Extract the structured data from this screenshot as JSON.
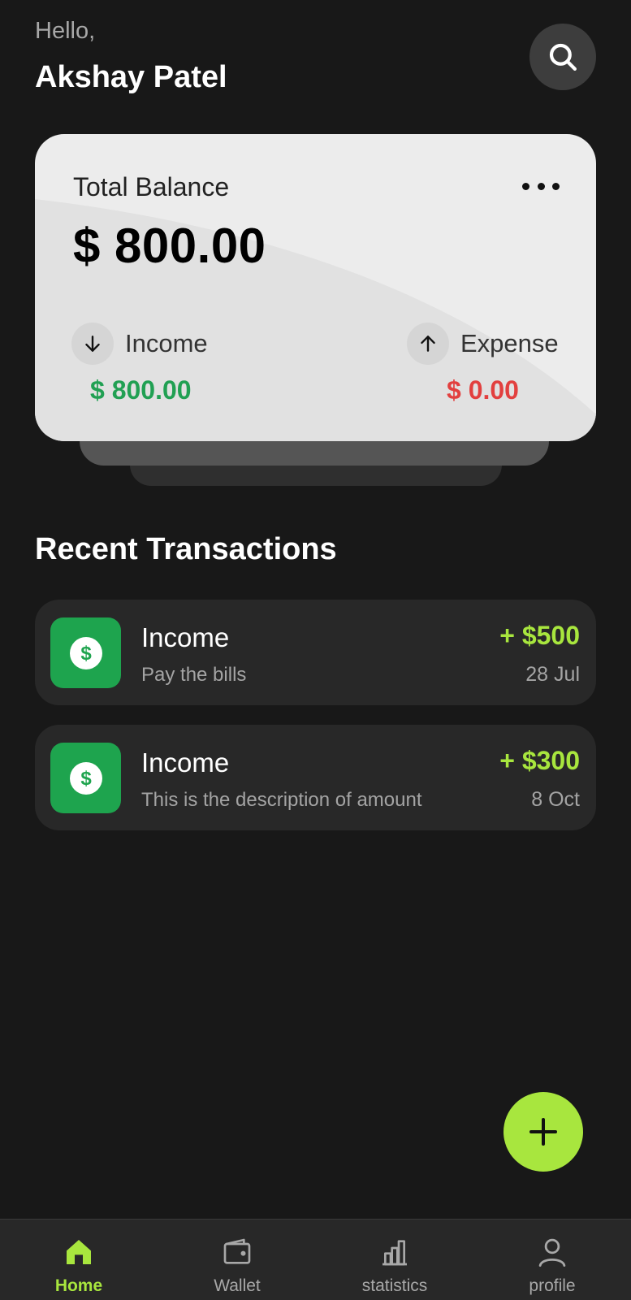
{
  "header": {
    "greeting": "Hello,",
    "username": "Akshay Patel",
    "search_icon": "search-icon"
  },
  "balance_card": {
    "label": "Total Balance",
    "value": "$ 800.00",
    "more_icon": "more-horizontal-icon",
    "income": {
      "label": "Income",
      "value": "$ 800.00",
      "icon": "arrow-down-icon",
      "color": "#21a053"
    },
    "expense": {
      "label": "Expense",
      "value": "$ 0.00",
      "icon": "arrow-up-icon",
      "color": "#e2403f"
    }
  },
  "recent": {
    "title": "Recent Transactions",
    "transactions": [
      {
        "title": "Income",
        "description": "Pay the bills",
        "amount": "+ $500",
        "date": "28 Jul",
        "icon": "dollar-icon"
      },
      {
        "title": "Income",
        "description": "This is the description of amount",
        "amount": "+ $300",
        "date": "8 Oct",
        "icon": "dollar-icon"
      }
    ]
  },
  "fab": {
    "icon": "plus-icon"
  },
  "bottom_nav": {
    "items": [
      {
        "label": "Home",
        "icon": "home-icon",
        "active": true
      },
      {
        "label": "Wallet",
        "icon": "wallet-icon",
        "active": false
      },
      {
        "label": "statistics",
        "icon": "bar-chart-icon",
        "active": false
      },
      {
        "label": "profile",
        "icon": "user-icon",
        "active": false
      }
    ]
  },
  "colors": {
    "background": "#181818",
    "accent": "#a8e63e",
    "income_green": "#21a053",
    "expense_red": "#e2403f",
    "card_bg": "#ececec",
    "item_bg": "#282828"
  }
}
